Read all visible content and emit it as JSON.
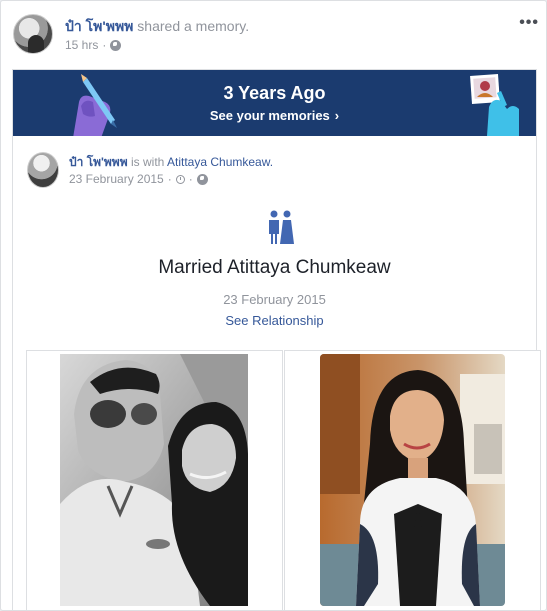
{
  "post": {
    "author": "ป๋า โพ'พพพ",
    "action": "shared a memory.",
    "time": "15 hrs",
    "more_glyph": "•••"
  },
  "banner": {
    "title": "3 Years Ago",
    "link": "See your memories",
    "link_arrow": "›",
    "bg_color": "#1b3b6f"
  },
  "inner_post": {
    "author": "ป๋า โพ'พพพ",
    "with_text": "is with",
    "tagged_friend": "Atittaya Chumkeaw.",
    "date": "23 February 2015",
    "separator": "·"
  },
  "life_event": {
    "icon": "couple-icon",
    "title": "Married Atittaya Chumkeaw",
    "date": "23 February 2015",
    "link": "See Relationship"
  },
  "colors": {
    "link": "#365899",
    "muted": "#90949c",
    "event_icon": "#4267b2"
  }
}
